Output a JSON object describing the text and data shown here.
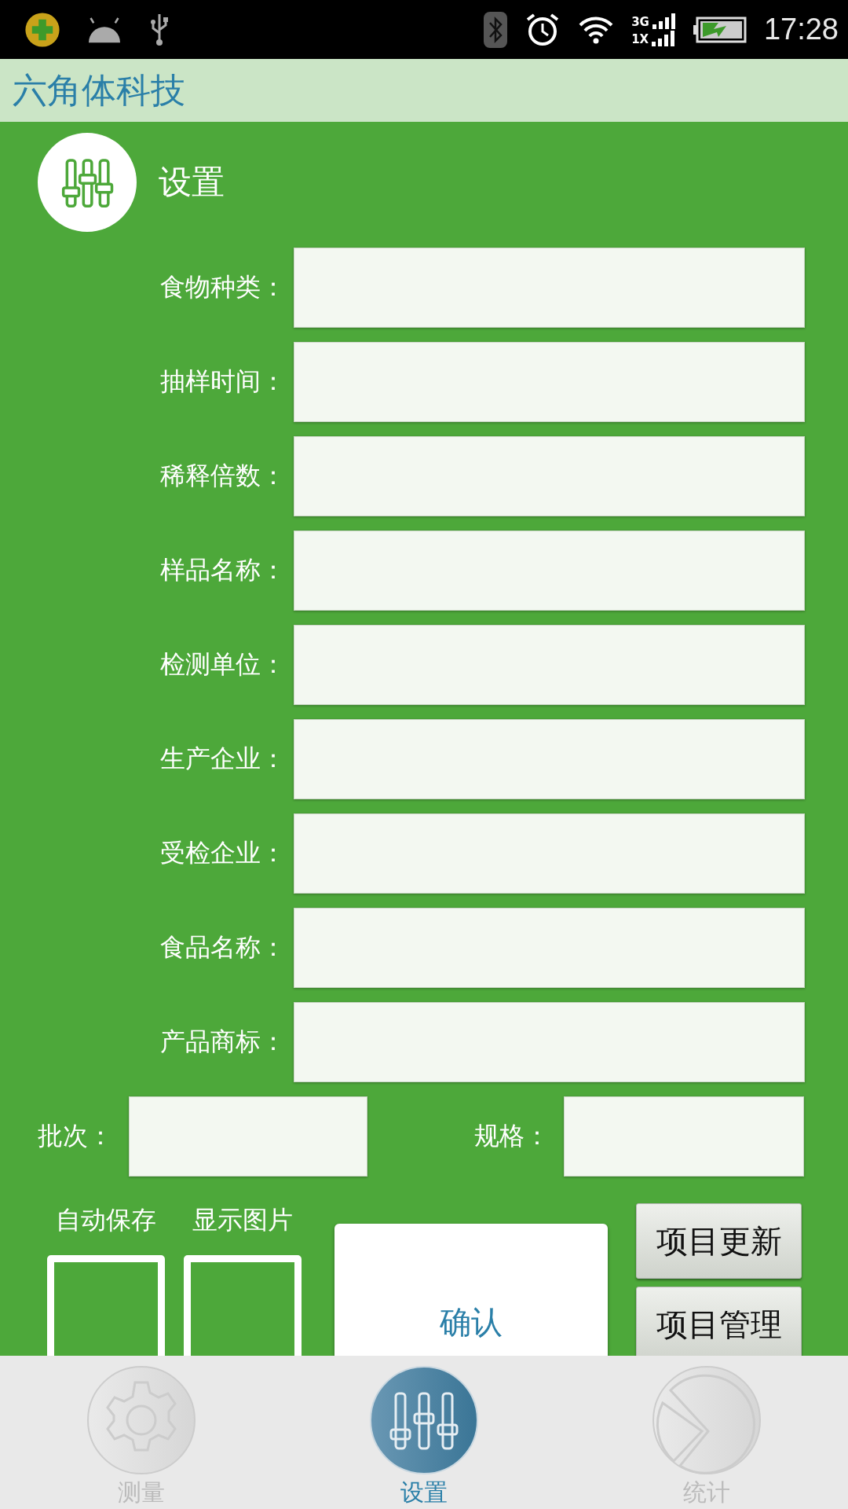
{
  "status_bar": {
    "network_top": "3G",
    "network_bottom": "1X",
    "time": "17:28"
  },
  "app_bar": {
    "title": "六角体科技"
  },
  "section": {
    "title": "设置"
  },
  "fields": [
    {
      "label": "食物种类："
    },
    {
      "label": "抽样时间："
    },
    {
      "label": "稀释倍数："
    },
    {
      "label": "样品名称："
    },
    {
      "label": "检测单位："
    },
    {
      "label": "生产企业："
    },
    {
      "label": "受检企业："
    },
    {
      "label": "食品名称："
    },
    {
      "label": "产品商标："
    }
  ],
  "short_fields": [
    {
      "label": "批次："
    },
    {
      "label": "规格："
    }
  ],
  "checkboxes": [
    {
      "label": "自动保存",
      "checked": false
    },
    {
      "label": "显示图片",
      "checked": false
    }
  ],
  "confirm_button": "确认",
  "side_buttons": [
    "项目更新",
    "项目管理"
  ],
  "tabs": [
    {
      "label": "测量",
      "kind": "gear",
      "selected": false
    },
    {
      "label": "设置",
      "kind": "sliders",
      "selected": true
    },
    {
      "label": "统计",
      "kind": "pie",
      "selected": false
    }
  ]
}
